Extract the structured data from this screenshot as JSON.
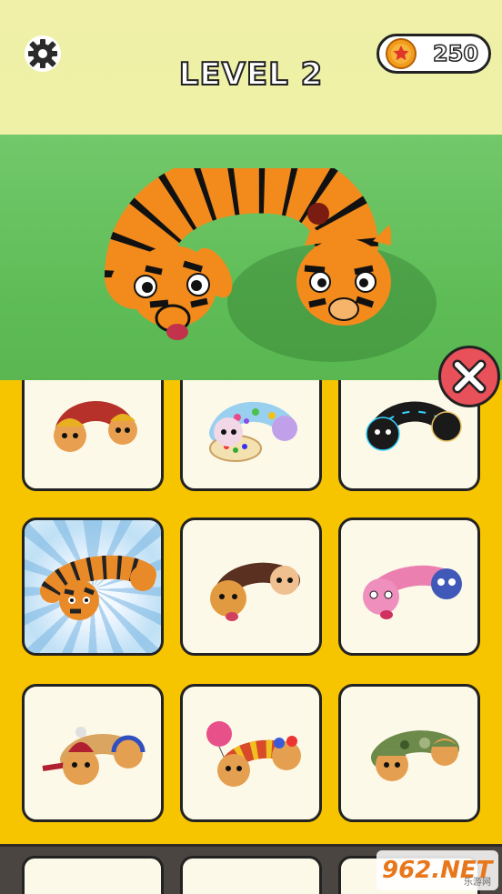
{
  "hud": {
    "level_label": "LEVEL 2",
    "coin_count": "250",
    "settings_icon": "gear-icon",
    "coin_icon": "star-coin-icon"
  },
  "skins": [
    {
      "name": "firefighter",
      "selected": false
    },
    {
      "name": "rainbow-paint",
      "selected": false
    },
    {
      "name": "neon-black",
      "selected": false
    },
    {
      "name": "tiger",
      "selected": true
    },
    {
      "name": "dog-cat",
      "selected": false
    },
    {
      "name": "pink-blue",
      "selected": false
    },
    {
      "name": "winter-headphones",
      "selected": false
    },
    {
      "name": "clown-balloon",
      "selected": false
    },
    {
      "name": "camo",
      "selected": false
    }
  ],
  "close_icon": "close-icon",
  "watermark": {
    "main": "962.NET",
    "sub": "乐游网"
  },
  "colors": {
    "panel": "#f7c400",
    "close": "#e8505a",
    "grass": "#5fbd57",
    "sky": "#eef1a6"
  }
}
